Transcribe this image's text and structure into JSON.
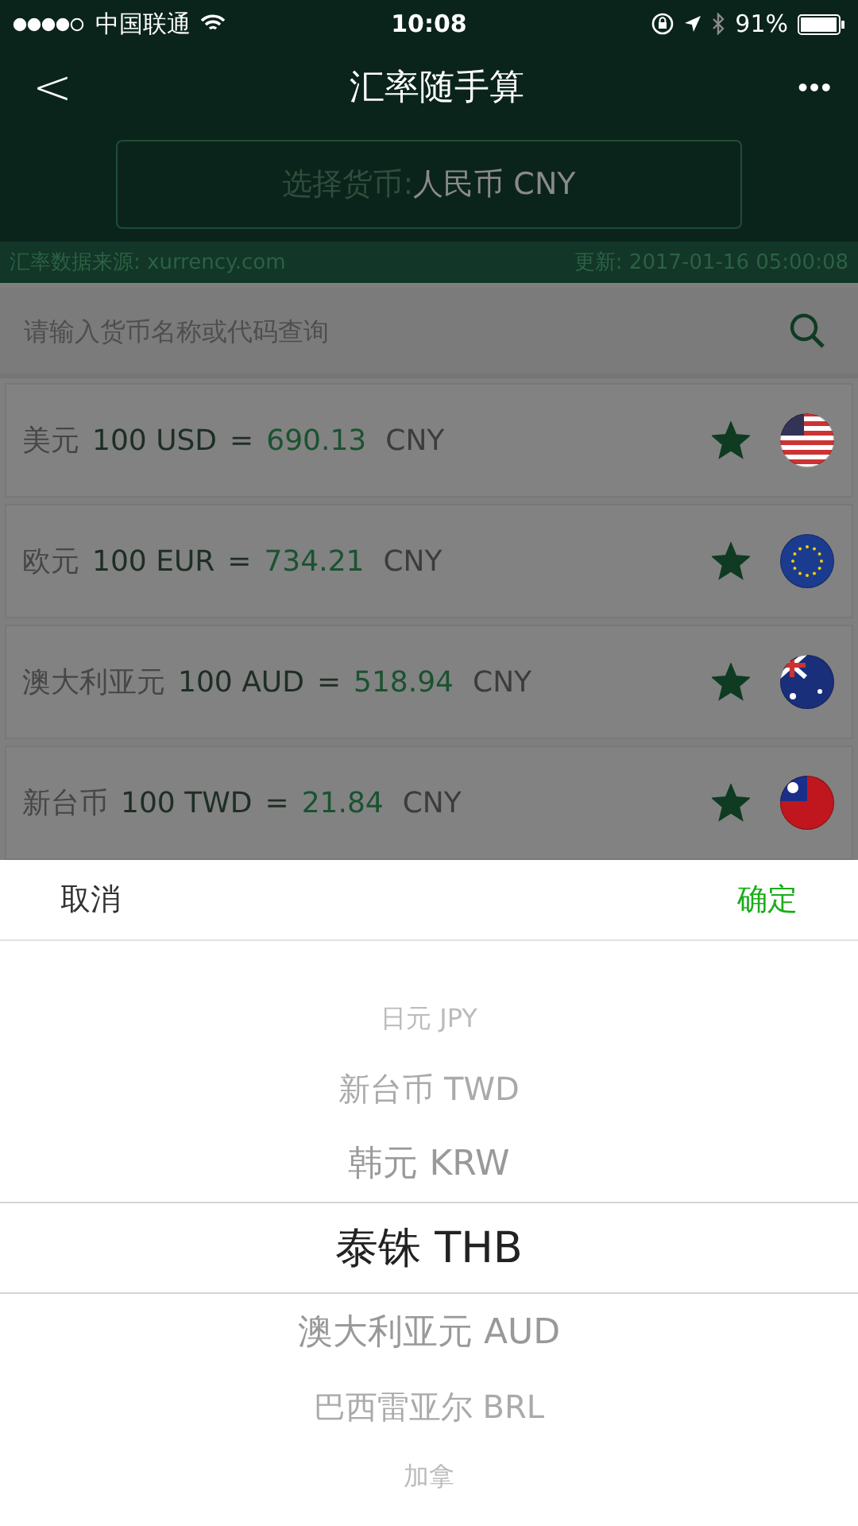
{
  "status_bar": {
    "carrier": "中国联通",
    "time": "10:08",
    "battery": "91%"
  },
  "nav": {
    "back": "<",
    "title": "汇率随手算",
    "more": "•••"
  },
  "currency_select": {
    "label": "选择货币: ",
    "value": "人民币 CNY"
  },
  "source_bar": {
    "source": "汇率数据来源: xurrency.com",
    "updated": "更新: 2017-01-16 05:00:08"
  },
  "search": {
    "placeholder": "请输入货币名称或代码查询"
  },
  "rates": [
    {
      "name": "美元",
      "amount": "100 USD",
      "equals": "=",
      "value": "690.13",
      "unit": "CNY",
      "starred": true,
      "kind": "us"
    },
    {
      "name": "欧元",
      "amount": "100 EUR",
      "equals": "=",
      "value": "734.21",
      "unit": "CNY",
      "starred": true,
      "kind": "eu"
    },
    {
      "name": "澳大利亚元",
      "amount": "100 AUD",
      "equals": "=",
      "value": "518.94",
      "unit": "CNY",
      "starred": true,
      "kind": "au"
    },
    {
      "name": "新台币",
      "amount": "100 TWD",
      "equals": "=",
      "value": "21.84",
      "unit": "CNY",
      "starred": true,
      "kind": "tw"
    }
  ],
  "picker": {
    "cancel": "取消",
    "confirm": "确定",
    "options": [
      {
        "label": "日元 JPY",
        "selected": false
      },
      {
        "label": "新台币 TWD",
        "selected": false
      },
      {
        "label": "韩元 KRW",
        "selected": false
      },
      {
        "label": "泰铢 THB",
        "selected": true
      },
      {
        "label": "澳大利亚元 AUD",
        "selected": false
      },
      {
        "label": "巴西雷亚尔 BRL",
        "selected": false
      },
      {
        "label": "加拿",
        "selected": false
      }
    ]
  }
}
